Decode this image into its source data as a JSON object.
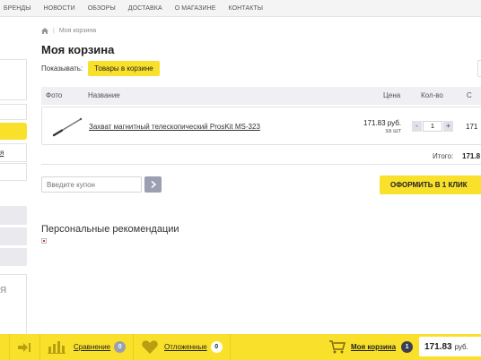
{
  "topnav": {
    "items": [
      "Бренды",
      "Новости",
      "Обзоры",
      "Доставка",
      "О магазине",
      "Контакты"
    ]
  },
  "sidebar": {
    "frag_text_1": "я",
    "frag_text_2": "Я"
  },
  "breadcrumb": {
    "current": "Моя корзина"
  },
  "page": {
    "title": "Моя корзина",
    "show_label": "Показывать:",
    "show_tab": "Товары в корзине"
  },
  "cart": {
    "columns": {
      "photo": "Фото",
      "name": "Название",
      "price": "Цена",
      "qty": "Кол-во",
      "total": "С"
    },
    "items": [
      {
        "name": "Захват магнитный телескопический ProsKit MS-323",
        "price": "171.83 руб.",
        "price_unit": "за шт",
        "qty": "1",
        "total": "171"
      }
    ],
    "totals_label": "Итого:",
    "totals_value": "171.8"
  },
  "coupon": {
    "placeholder": "Введите купон"
  },
  "order_button": "ОФОРМИТЬ В 1 КЛИК",
  "recommendations": {
    "title": "Персональные рекомендации"
  },
  "bottombar": {
    "compare_label": "Сравнение",
    "compare_count": "0",
    "deferred_label": "Отложенные",
    "deferred_count": "0",
    "cart_label": "Моя корзина",
    "cart_count": "1",
    "cart_total": "171.83",
    "currency": "руб."
  },
  "colors": {
    "accent_yellow": "#f9e12b",
    "badge_grey": "#9aa0b2",
    "badge_dark": "#3c3f55"
  }
}
